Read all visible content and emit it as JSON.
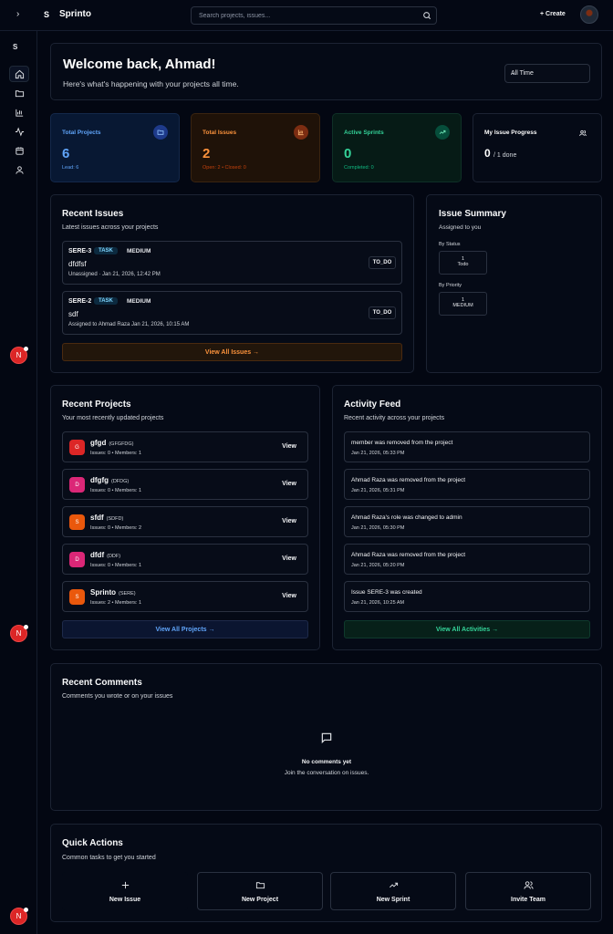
{
  "header": {
    "logo_letter": "S",
    "brand": "Sprinto",
    "search_placeholder": "Search projects, issues...",
    "create_label": "+ Create"
  },
  "sidebar": {
    "logo_letter": "S",
    "badge_letter": "N"
  },
  "welcome": {
    "title": "Welcome back, Ahmad!",
    "subtitle": "Here's what's happening with your projects all time.",
    "range": "All Time"
  },
  "stats": [
    {
      "label": "Total Projects",
      "value": "6",
      "note": "Lead: 6",
      "color": "#60a5fa"
    },
    {
      "label": "Total Issues",
      "value": "2",
      "note": "Open: 2 • Closed: 0",
      "color": "#fb923c"
    },
    {
      "label": "Active Sprints",
      "value": "0",
      "note": "Completed: 0",
      "color": "#34d399"
    },
    {
      "label": "My Issue Progress",
      "value": "0",
      "value_suffix": "/ 1 done",
      "color": "#ffffff"
    }
  ],
  "recent_issues": {
    "title": "Recent Issues",
    "subtitle": "Latest issues across your projects",
    "items": [
      {
        "key": "SERE-3",
        "type": "TASK",
        "priority": "MEDIUM",
        "title": "dfdfsf",
        "meta": "Unassigned  ·  Jan 21, 2026, 12:42 PM",
        "status": "TO_DO"
      },
      {
        "key": "SERE-2",
        "type": "TASK",
        "priority": "MEDIUM",
        "title": "sdf",
        "meta": "Assigned to Ahmad Raza      Jan 21, 2026, 10:15 AM",
        "status": "TO_DO"
      }
    ],
    "view_all": "View All Issues →"
  },
  "issue_summary": {
    "title": "Issue Summary",
    "subtitle": "Assigned to you",
    "by_status_label": "By Status",
    "status_count": "1",
    "status_name": "Todo",
    "by_priority_label": "By Priority",
    "priority_count": "1",
    "priority_name": "MEDIUM"
  },
  "recent_projects": {
    "title": "Recent Projects",
    "subtitle": "Your most recently updated projects",
    "items": [
      {
        "initial": "G",
        "name": "gfgd",
        "key": "(GFGFDG)",
        "meta": "Issues: 0 • Members: 1",
        "color": "#dc2626"
      },
      {
        "initial": "D",
        "name": "dfgfg",
        "key": "(DFDG)",
        "meta": "Issues: 0 • Members: 1",
        "color": "#db2777"
      },
      {
        "initial": "S",
        "name": "sfdf",
        "key": "(SDFD)",
        "meta": "Issues: 0 • Members: 2",
        "color": "#ea580c"
      },
      {
        "initial": "D",
        "name": "dfdf",
        "key": "(DDF)",
        "meta": "Issues: 0 • Members: 1",
        "color": "#db2777"
      },
      {
        "initial": "S",
        "name": "Sprinto",
        "key": "(SERE)",
        "meta": "Issues: 2 • Members: 1",
        "color": "#ea580c"
      }
    ],
    "view_label": "View",
    "view_all": "View All Projects →"
  },
  "activity_feed": {
    "title": "Activity Feed",
    "subtitle": "Recent activity across your projects",
    "items": [
      {
        "text": "member was removed from the project",
        "time": "Jan 21, 2026, 05:33 PM"
      },
      {
        "text": "Ahmad Raza was removed from the project",
        "time": "Jan 21, 2026, 05:31 PM"
      },
      {
        "text": "Ahmad Raza's role was changed to admin",
        "time": "Jan 21, 2026, 05:30 PM"
      },
      {
        "text": "Ahmad Raza was removed from the project",
        "time": "Jan 21, 2026, 05:20 PM"
      },
      {
        "text": "Issue SERE-3 was created",
        "time": "Jan 21, 2026, 10:25 AM"
      }
    ],
    "view_all": "View All Activities →"
  },
  "recent_comments": {
    "title": "Recent Comments",
    "subtitle": "Comments you wrote or on your issues",
    "empty_title": "No comments yet",
    "empty_subtitle": "Join the conversation on issues."
  },
  "quick_actions": {
    "title": "Quick Actions",
    "subtitle": "Common tasks to get you started",
    "items": [
      {
        "label": "New Issue",
        "icon": "plus-icon"
      },
      {
        "label": "New Project",
        "icon": "folder-icon"
      },
      {
        "label": "New Sprint",
        "icon": "trending-up-icon"
      },
      {
        "label": "Invite Team",
        "icon": "users-icon"
      }
    ]
  }
}
